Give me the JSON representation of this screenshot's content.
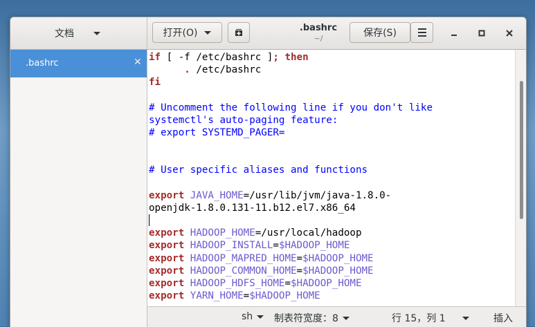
{
  "sidebar": {
    "documents_label": "文档",
    "items": [
      {
        "label": ".bashrc"
      }
    ]
  },
  "header": {
    "open_label": "打开(O)",
    "save_label": "保存(S)",
    "title": ".bashrc",
    "subtitle": "~/"
  },
  "editor": {
    "lines": [
      "if [ -f /etc/bashrc ]; then",
      "      . /etc/bashrc",
      "fi",
      "",
      "# Uncomment the following line if you don't like",
      "systemctl's auto-paging feature:",
      "# export SYSTEMD_PAGER=",
      "",
      "",
      "# User specific aliases and functions",
      "",
      "export JAVA_HOME=/usr/lib/jvm/java-1.8.0-",
      "openjdk-1.8.0.131-11.b12.el7.x86_64",
      "",
      "export HADOOP_HOME=/usr/local/hadoop",
      "export HADOOP_INSTALL=$HADOOP_HOME",
      "export HADOOP_MAPRED_HOME=$HADOOP_HOME",
      "export HADOOP_COMMON_HOME=$HADOOP_HOME",
      "export HADOOP_HDFS_HOME=$HADOOP_HOME",
      "export YARN_HOME=$HADOOP_HOME"
    ]
  },
  "status": {
    "language": "sh",
    "tab_width": "制表符宽度：8",
    "position": "行 15，列 1",
    "mode": "插入"
  },
  "colors": {
    "accent": "#4a90d9",
    "keyword": "#a52a2a",
    "comment": "#0000ff",
    "identifier": "#6a5acd"
  }
}
